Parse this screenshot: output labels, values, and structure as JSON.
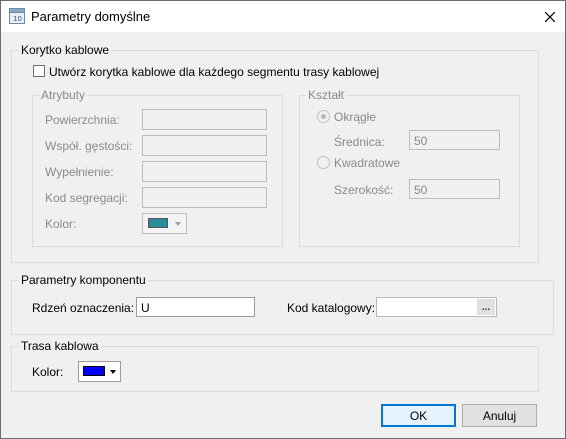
{
  "window": {
    "title": "Parametry domyślne"
  },
  "cable_trays": {
    "group_title": "Korytko kablowe",
    "create_checkbox_label": "Utwórz korytka kablowe dla każdego segmentu trasy kablowej",
    "create_checked": false,
    "attributes": {
      "title": "Atrybuty",
      "surface_label": "Powierzchnia:",
      "density_label": "Współ. gęstości:",
      "fill_label": "Wypełnienie:",
      "segregation_label": "Kod segregacji:",
      "color_label": "Kolor:",
      "color": "#2b8a9b"
    },
    "shape": {
      "title": "Kształt",
      "round_label": "Okrągłe",
      "diameter_label": "Średnica:",
      "diameter_value": "50",
      "square_label": "Kwadratowe",
      "width_label": "Szerokość:",
      "width_value": "50",
      "selected": "round"
    }
  },
  "component_params": {
    "group_title": "Parametry komponentu",
    "designator_label": "Rdzeń oznaczenia:",
    "designator_value": "U",
    "catalog_label": "Kod katalogowy:",
    "catalog_value": "",
    "browse_label": "..."
  },
  "cable_route": {
    "group_title": "Trasa kablowa",
    "color_label": "Kolor:",
    "color": "#0000ff"
  },
  "buttons": {
    "ok": "OK",
    "cancel": "Anuluj"
  }
}
